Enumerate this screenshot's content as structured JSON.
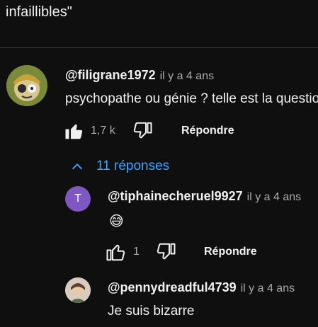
{
  "top_text": "infaillibles\"",
  "comment": {
    "handle": "@filigrane1972",
    "time": "il y a 4 ans",
    "text": "psychopathe ou génie ? telle est la question",
    "likes": "1,7 k",
    "reply_label": "Répondre"
  },
  "replies_toggle": "11 réponses",
  "replies": [
    {
      "handle": "@tiphainecheruel9927",
      "time": "il y a 4 ans",
      "avatar_letter": "T",
      "avatar_color": "#7e57c2",
      "text": "😅",
      "likes": "1",
      "reply_label": "Répondre"
    },
    {
      "handle": "@pennydreadful4739",
      "time": "il y a 4 ans",
      "text": "Je suis bizarre"
    }
  ],
  "colors": {
    "background": "#0f0f0f",
    "link": "#3ea6ff",
    "secondary_text": "#aaaaaa"
  }
}
